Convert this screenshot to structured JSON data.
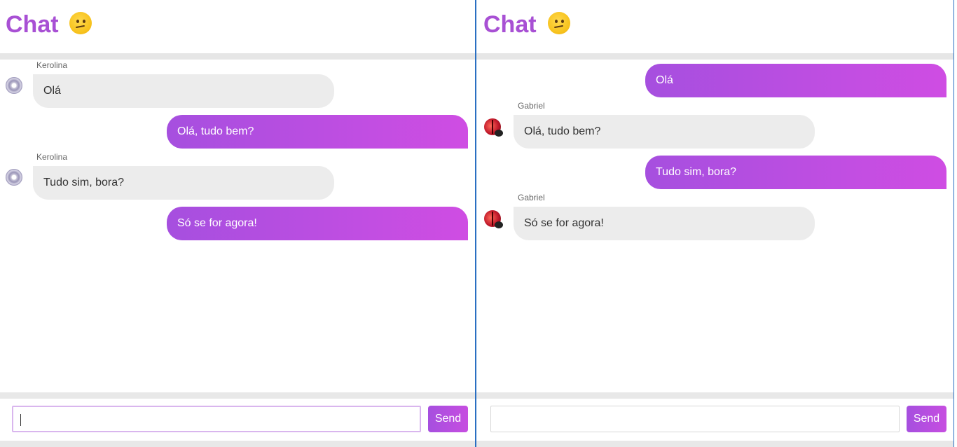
{
  "left_panel": {
    "title": "Chat",
    "emoji": "confused-face",
    "messages": [
      {
        "sender": "Kerolina",
        "text": "Olá",
        "direction": "in",
        "avatar": "disc-icon"
      },
      {
        "text": "Olá, tudo bem?",
        "direction": "out"
      },
      {
        "sender": "Kerolina",
        "text": "Tudo sim, bora?",
        "direction": "in",
        "avatar": "disc-icon"
      },
      {
        "text": "Só se for agora!",
        "direction": "out"
      }
    ],
    "input_value": "",
    "send_label": "Send"
  },
  "right_panel": {
    "title": "Chat",
    "emoji": "confused-face",
    "messages": [
      {
        "text": "Olá",
        "direction": "out"
      },
      {
        "sender": "Gabriel",
        "text": "Olá, tudo bem?",
        "direction": "in",
        "avatar": "ladybug-icon"
      },
      {
        "text": "Tudo sim, bora?",
        "direction": "out"
      },
      {
        "sender": "Gabriel",
        "text": "Só se for agora!",
        "direction": "in",
        "avatar": "ladybug-icon"
      }
    ],
    "input_value": "",
    "send_label": "Send"
  },
  "colors": {
    "accent": "#a850d4",
    "bubble_out_start": "#a64fdf",
    "bubble_out_end": "#cf4de3",
    "bubble_in": "#ececec",
    "divider": "#2a6fc2"
  }
}
